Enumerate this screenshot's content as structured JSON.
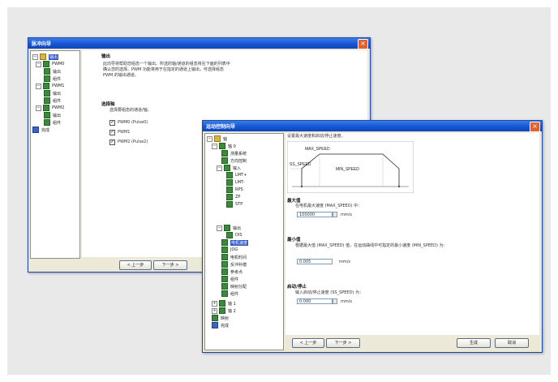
{
  "back_window": {
    "title": "脉冲向导",
    "tree": [
      {
        "label": "输出",
        "sel": true
      },
      {
        "label": "PWM0"
      },
      {
        "label": "输出"
      },
      {
        "label": "组件"
      },
      {
        "label": "PWM1"
      },
      {
        "label": "输出"
      },
      {
        "label": "组件"
      },
      {
        "label": "PWM2"
      },
      {
        "label": "输出"
      },
      {
        "label": "组件"
      },
      {
        "label": "完成"
      }
    ],
    "section_title": "输出",
    "intro": [
      "此向导将帮助您组态一个输出。所选的轴/通道的组态将在下面的列表中",
      "确认您的选择。PWM 功能将用于在指定的通道上输出，可选择组态",
      "PWM 的输出通道。"
    ],
    "section2_title": "选择轴",
    "section2_text": "选择要组态的通道/轴。",
    "checks": [
      "PWM0 (Pulse0)",
      "PWM1",
      "PWM2 (Pulse2)"
    ],
    "prev_button": "< 上一步",
    "next_button": "下一步 >"
  },
  "front_window": {
    "title": "运动控制向导",
    "tree": [
      {
        "label": "轴"
      },
      {
        "label": "轴 0"
      },
      {
        "label": "测量系统"
      },
      {
        "label": "方向控制"
      },
      {
        "label": "输入"
      },
      {
        "label": "LMT+"
      },
      {
        "label": "LMT-"
      },
      {
        "label": "RPS"
      },
      {
        "label": "ZP"
      },
      {
        "label": "STP"
      },
      {
        "label": "输出"
      },
      {
        "label": "DIS"
      },
      {
        "label": "电机速度",
        "sel": true
      },
      {
        "label": "JOG"
      },
      {
        "label": "电机时间"
      },
      {
        "label": "反冲补偿"
      },
      {
        "label": "参考点"
      },
      {
        "label": "组件"
      },
      {
        "label": "映射分配"
      },
      {
        "label": "组件"
      },
      {
        "label": "轴 1"
      },
      {
        "label": "轴 2"
      },
      {
        "label": "映射"
      },
      {
        "label": "完成"
      }
    ],
    "top_text": "设置最大速度和启动/停止速度。",
    "graph": {
      "max_label": "MAX_SPEED",
      "ss_label": "SS_SPEED",
      "min_label": "MIN_SPEED"
    },
    "max_title": "最大值",
    "max_text": "在电机最大速度 (MAX_SPEED) 中：",
    "max_value": "100000",
    "max_unit": "mm/s",
    "min_title": "最小值",
    "min_text": "根据最大值 (MAX_SPEED) 值，在运动曲线中可指定的最小速度 (MIN_SPEED) 为：",
    "min_value": "0.005",
    "min_unit": "mm/s",
    "ss_title": "启动/停止",
    "ss_text": "输入启动/停止速度 (SS_SPEED) 为：",
    "ss_value": "0.000",
    "ss_unit": "mm/s",
    "prev_button": "< 上一步",
    "next_button": "下一步 >",
    "generate_button": "生成",
    "cancel_button": "取消"
  },
  "colors": {
    "titlebar": "#1556d4",
    "panel_background": "#e9e9ea",
    "selection": "#2f56c5"
  }
}
